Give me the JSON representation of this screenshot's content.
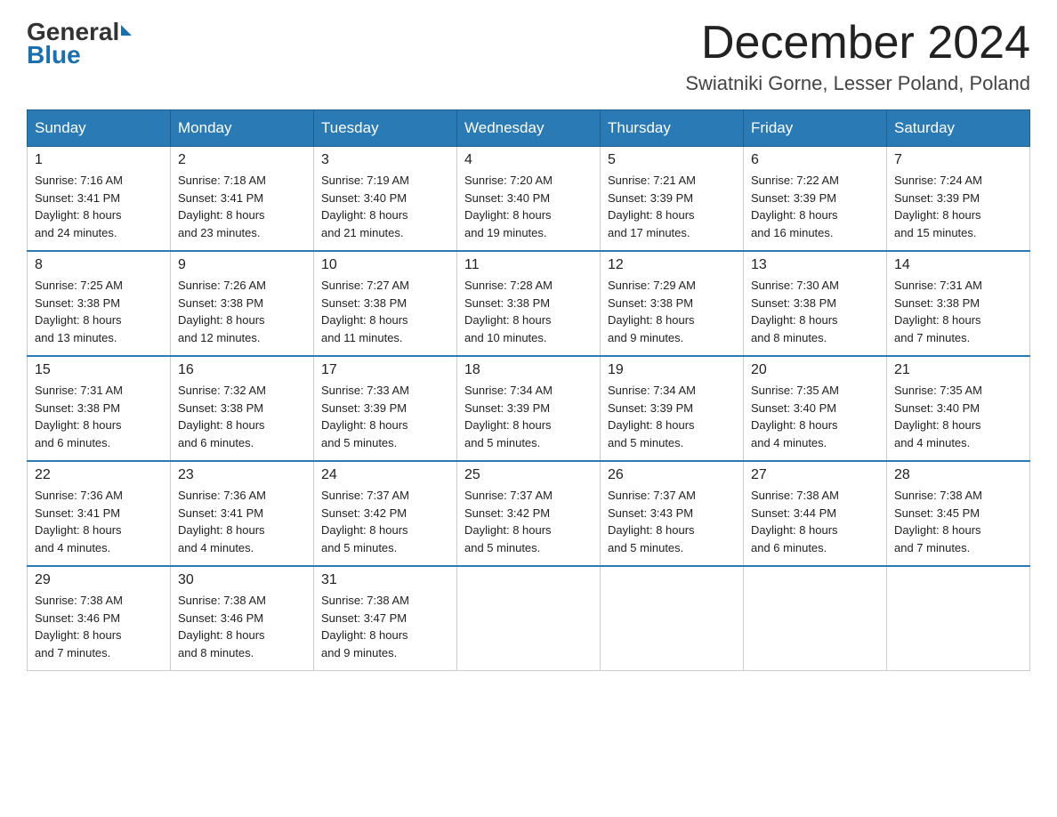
{
  "header": {
    "logo_general": "General",
    "logo_blue": "Blue",
    "month_title": "December 2024",
    "location": "Swiatniki Gorne, Lesser Poland, Poland"
  },
  "days_of_week": [
    "Sunday",
    "Monday",
    "Tuesday",
    "Wednesday",
    "Thursday",
    "Friday",
    "Saturday"
  ],
  "weeks": [
    [
      {
        "day": "1",
        "sunrise": "7:16 AM",
        "sunset": "3:41 PM",
        "daylight": "8 hours and 24 minutes."
      },
      {
        "day": "2",
        "sunrise": "7:18 AM",
        "sunset": "3:41 PM",
        "daylight": "8 hours and 23 minutes."
      },
      {
        "day": "3",
        "sunrise": "7:19 AM",
        "sunset": "3:40 PM",
        "daylight": "8 hours and 21 minutes."
      },
      {
        "day": "4",
        "sunrise": "7:20 AM",
        "sunset": "3:40 PM",
        "daylight": "8 hours and 19 minutes."
      },
      {
        "day": "5",
        "sunrise": "7:21 AM",
        "sunset": "3:39 PM",
        "daylight": "8 hours and 17 minutes."
      },
      {
        "day": "6",
        "sunrise": "7:22 AM",
        "sunset": "3:39 PM",
        "daylight": "8 hours and 16 minutes."
      },
      {
        "day": "7",
        "sunrise": "7:24 AM",
        "sunset": "3:39 PM",
        "daylight": "8 hours and 15 minutes."
      }
    ],
    [
      {
        "day": "8",
        "sunrise": "7:25 AM",
        "sunset": "3:38 PM",
        "daylight": "8 hours and 13 minutes."
      },
      {
        "day": "9",
        "sunrise": "7:26 AM",
        "sunset": "3:38 PM",
        "daylight": "8 hours and 12 minutes."
      },
      {
        "day": "10",
        "sunrise": "7:27 AM",
        "sunset": "3:38 PM",
        "daylight": "8 hours and 11 minutes."
      },
      {
        "day": "11",
        "sunrise": "7:28 AM",
        "sunset": "3:38 PM",
        "daylight": "8 hours and 10 minutes."
      },
      {
        "day": "12",
        "sunrise": "7:29 AM",
        "sunset": "3:38 PM",
        "daylight": "8 hours and 9 minutes."
      },
      {
        "day": "13",
        "sunrise": "7:30 AM",
        "sunset": "3:38 PM",
        "daylight": "8 hours and 8 minutes."
      },
      {
        "day": "14",
        "sunrise": "7:31 AM",
        "sunset": "3:38 PM",
        "daylight": "8 hours and 7 minutes."
      }
    ],
    [
      {
        "day": "15",
        "sunrise": "7:31 AM",
        "sunset": "3:38 PM",
        "daylight": "8 hours and 6 minutes."
      },
      {
        "day": "16",
        "sunrise": "7:32 AM",
        "sunset": "3:38 PM",
        "daylight": "8 hours and 6 minutes."
      },
      {
        "day": "17",
        "sunrise": "7:33 AM",
        "sunset": "3:39 PM",
        "daylight": "8 hours and 5 minutes."
      },
      {
        "day": "18",
        "sunrise": "7:34 AM",
        "sunset": "3:39 PM",
        "daylight": "8 hours and 5 minutes."
      },
      {
        "day": "19",
        "sunrise": "7:34 AM",
        "sunset": "3:39 PM",
        "daylight": "8 hours and 5 minutes."
      },
      {
        "day": "20",
        "sunrise": "7:35 AM",
        "sunset": "3:40 PM",
        "daylight": "8 hours and 4 minutes."
      },
      {
        "day": "21",
        "sunrise": "7:35 AM",
        "sunset": "3:40 PM",
        "daylight": "8 hours and 4 minutes."
      }
    ],
    [
      {
        "day": "22",
        "sunrise": "7:36 AM",
        "sunset": "3:41 PM",
        "daylight": "8 hours and 4 minutes."
      },
      {
        "day": "23",
        "sunrise": "7:36 AM",
        "sunset": "3:41 PM",
        "daylight": "8 hours and 4 minutes."
      },
      {
        "day": "24",
        "sunrise": "7:37 AM",
        "sunset": "3:42 PM",
        "daylight": "8 hours and 5 minutes."
      },
      {
        "day": "25",
        "sunrise": "7:37 AM",
        "sunset": "3:42 PM",
        "daylight": "8 hours and 5 minutes."
      },
      {
        "day": "26",
        "sunrise": "7:37 AM",
        "sunset": "3:43 PM",
        "daylight": "8 hours and 5 minutes."
      },
      {
        "day": "27",
        "sunrise": "7:38 AM",
        "sunset": "3:44 PM",
        "daylight": "8 hours and 6 minutes."
      },
      {
        "day": "28",
        "sunrise": "7:38 AM",
        "sunset": "3:45 PM",
        "daylight": "8 hours and 7 minutes."
      }
    ],
    [
      {
        "day": "29",
        "sunrise": "7:38 AM",
        "sunset": "3:46 PM",
        "daylight": "8 hours and 7 minutes."
      },
      {
        "day": "30",
        "sunrise": "7:38 AM",
        "sunset": "3:46 PM",
        "daylight": "8 hours and 8 minutes."
      },
      {
        "day": "31",
        "sunrise": "7:38 AM",
        "sunset": "3:47 PM",
        "daylight": "8 hours and 9 minutes."
      },
      null,
      null,
      null,
      null
    ]
  ],
  "labels": {
    "sunrise": "Sunrise:",
    "sunset": "Sunset:",
    "daylight": "Daylight:"
  }
}
